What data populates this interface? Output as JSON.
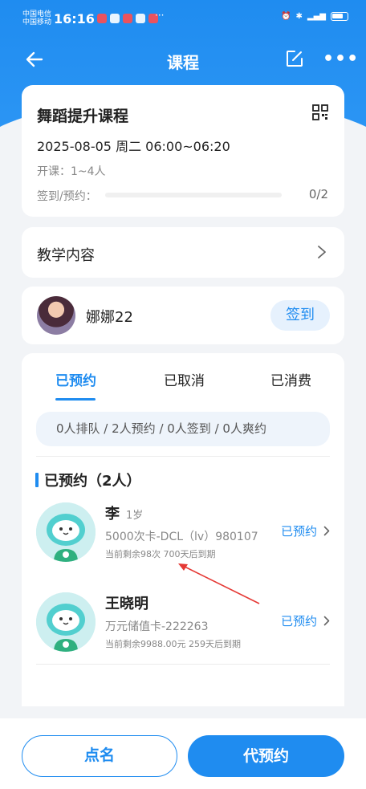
{
  "status_bar": {
    "carrier_1": "中国电信",
    "carrier_2": "中国移动",
    "time": "16:16",
    "dots": "···"
  },
  "nav": {
    "title": "课程",
    "more": "•••"
  },
  "course": {
    "title": "舞蹈提升课程",
    "datetime": "2025-08-05 周二 06:00~06:20",
    "size": "开课：1~4人",
    "signin_label": "签到/预约：",
    "signin_value": "0/2",
    "signin_progress": 0
  },
  "teaching": {
    "label": "教学内容"
  },
  "coach": {
    "name": "娜娜22",
    "sign_button": "签到"
  },
  "tabs": [
    {
      "label": "已预约"
    },
    {
      "label": "已取消"
    },
    {
      "label": "已消费"
    }
  ],
  "summary": "0人排队 / 2人预约 / 0人签到 / 0人爽约",
  "section_title": "已预约（2人）",
  "members": [
    {
      "name": "李",
      "age": "1岁",
      "card": "5000次卡-DCL（lv）980107",
      "remain": "当前剩余98次 700天后到期",
      "status": "已预约"
    },
    {
      "name": "王晓明",
      "age": "",
      "card": "万元储值卡-222263",
      "remain": "当前剩余9988.00元 259天后到期",
      "status": "已预约"
    }
  ],
  "bottom": {
    "roll_call": "点名",
    "book_for": "代预约"
  },
  "colors": {
    "primary": "#1f8cf0",
    "annotation_arrow": "#e53935"
  }
}
